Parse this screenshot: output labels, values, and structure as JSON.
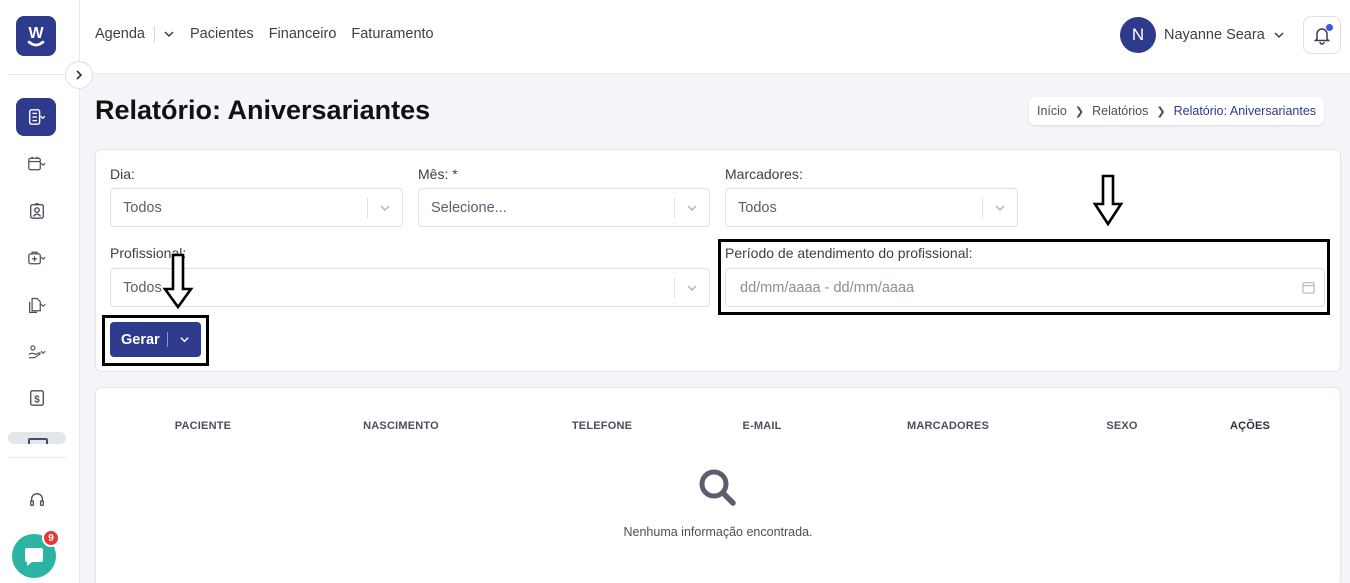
{
  "app": {
    "logo_letter": "W"
  },
  "nav": {
    "items": [
      {
        "label": "Agenda"
      },
      {
        "label": "Pacientes"
      },
      {
        "label": "Financeiro"
      },
      {
        "label": "Faturamento"
      }
    ]
  },
  "user": {
    "initial": "N",
    "name": "Nayanne Seara"
  },
  "sidebar": {
    "icons": [
      "reports-icon",
      "calendar-icon",
      "patient-badge-icon",
      "medical-kit-icon",
      "documents-icon",
      "hand-care-icon",
      "billing-icon",
      "headset-icon"
    ]
  },
  "chat": {
    "badge_count": "9"
  },
  "page": {
    "title": "Relatório: Aniversariantes"
  },
  "breadcrumb": {
    "items": [
      {
        "label": "Início"
      },
      {
        "label": "Relatórios"
      },
      {
        "label": "Relatório: Aniversariantes"
      }
    ]
  },
  "filters": {
    "dia": {
      "label": "Dia:",
      "value": "Todos"
    },
    "mes": {
      "label": "Mês: *",
      "value": "Selecione..."
    },
    "marcadores": {
      "label": "Marcadores:",
      "value": "Todos"
    },
    "profissional": {
      "label": "Profissional:",
      "value": "Todos"
    },
    "periodo": {
      "label": "Período de atendimento do profissional:",
      "placeholder": "dd/mm/aaaa - dd/mm/aaaa"
    },
    "generate_label": "Gerar"
  },
  "table": {
    "columns": [
      "PACIENTE",
      "NASCIMENTO",
      "TELEFONE",
      "E-MAIL",
      "MARCADORES",
      "SEXO",
      "AÇÕES"
    ],
    "empty_message": "Nenhuma informação encontrada."
  },
  "colors": {
    "primary": "#2e3a8c",
    "chat": "#2bb3a3",
    "badge": "#e53935"
  }
}
